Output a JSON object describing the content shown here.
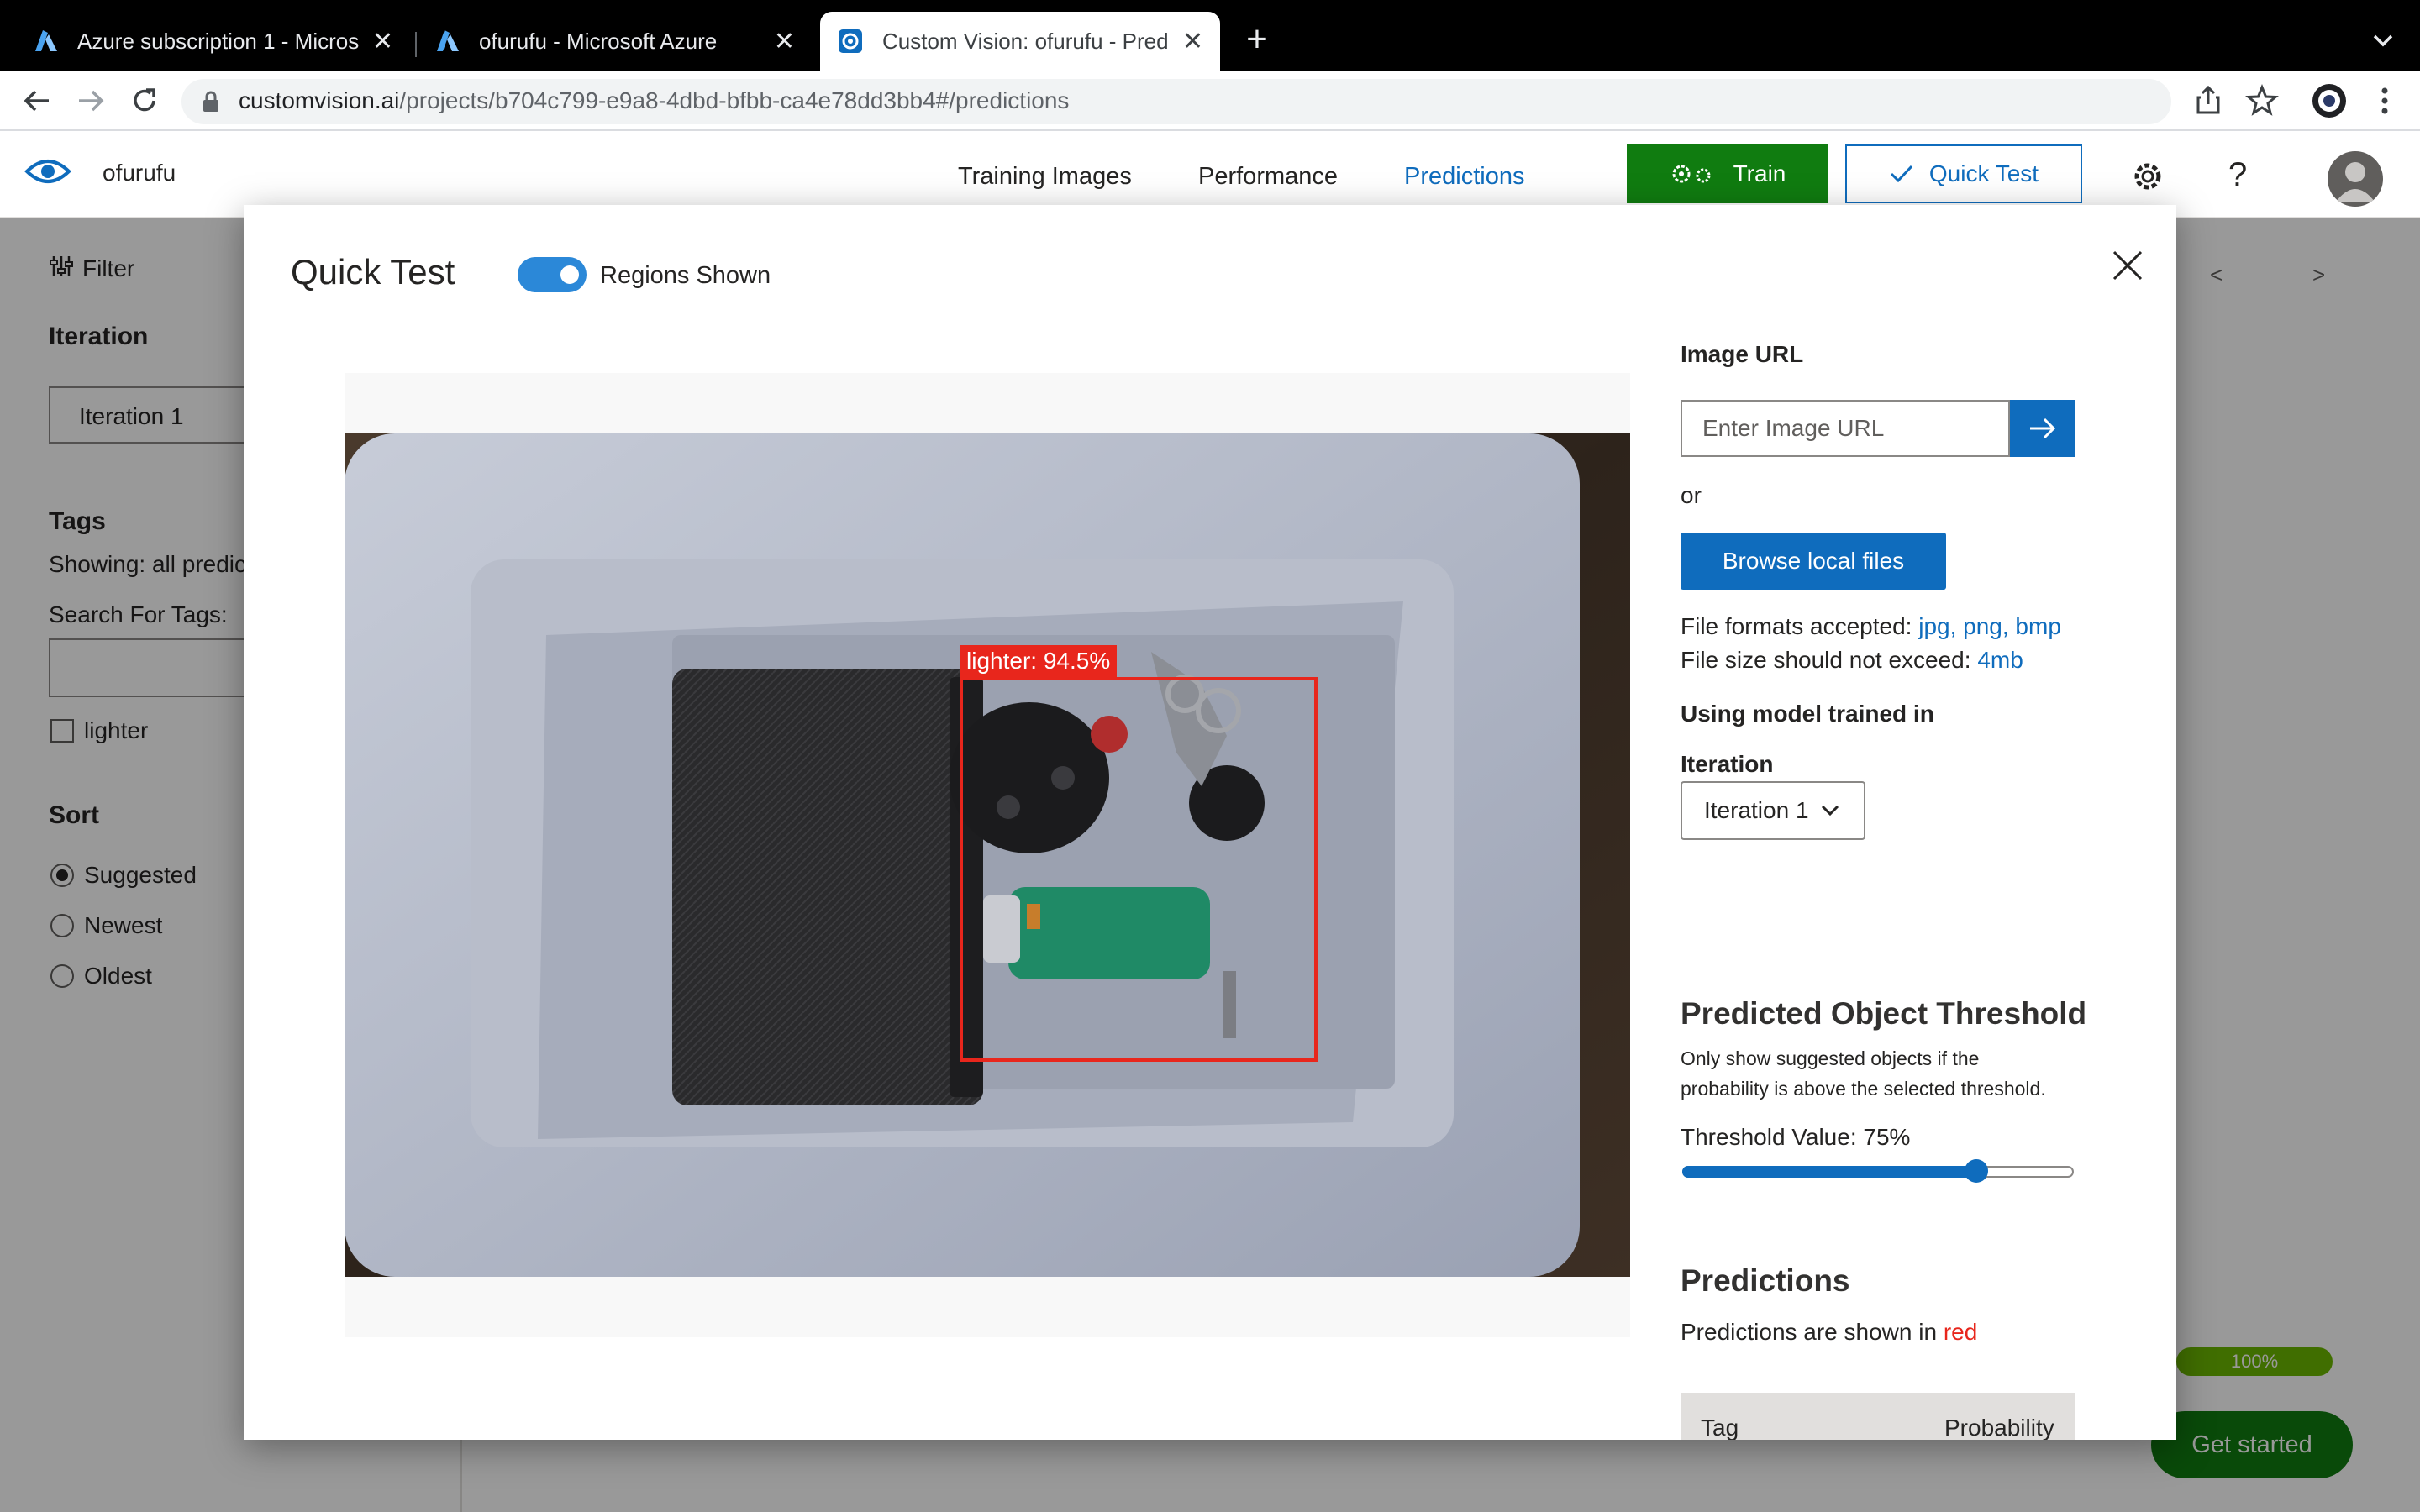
{
  "browser": {
    "tabs": [
      {
        "title": "Azure subscription 1 - Microso",
        "favicon": "azure-icon",
        "active": false
      },
      {
        "title": "ofurufu - Microsoft Azure",
        "favicon": "azure-icon",
        "active": false
      },
      {
        "title": "Custom Vision: ofurufu - Predic",
        "favicon": "custom-vision-icon",
        "active": true
      }
    ],
    "close_glyph": "✕",
    "new_tab_glyph": "+",
    "url_host": "customvision.ai",
    "url_path": "/projects/b704c799-e9a8-4dbd-bfbb-ca4e78dd3bb4#/predictions"
  },
  "app": {
    "project_name": "ofurufu",
    "nav": [
      {
        "label": "Training Images",
        "active": false
      },
      {
        "label": "Performance",
        "active": false
      },
      {
        "label": "Predictions",
        "active": true
      }
    ],
    "train_label": "Train",
    "quick_test_label": "Quick Test",
    "help_glyph": "?"
  },
  "sidebar": {
    "filter_label": "Filter",
    "iteration_heading": "Iteration",
    "iteration_value": "Iteration 1",
    "tags_heading": "Tags",
    "showing_text": "Showing: all predic",
    "search_tags_label": "Search For Tags:",
    "tag_items": [
      "lighter"
    ],
    "sort_heading": "Sort",
    "sort_options": [
      {
        "label": "Suggested",
        "checked": true
      },
      {
        "label": "Newest",
        "checked": false
      },
      {
        "label": "Oldest",
        "checked": false
      }
    ]
  },
  "background": {
    "pager_prev": "<",
    "pager_next": ">",
    "progress_label": "100%",
    "progress_value": 1.0,
    "get_started_label": "Get started"
  },
  "quick_test": {
    "title": "Quick Test",
    "regions_toggle_label": "Regions Shown",
    "regions_shown": true,
    "image_url_label": "Image URL",
    "image_url_placeholder": "Enter Image URL",
    "or_label": "or",
    "browse_label": "Browse local files",
    "file_formats_prefix": "File formats accepted:",
    "file_formats": "jpg, png, bmp",
    "file_size_prefix": "File size should not exceed:",
    "file_size": "4mb",
    "model_heading": "Using model trained in",
    "iteration_label": "Iteration",
    "iteration_selected": "Iteration 1",
    "threshold_title": "Predicted Object Threshold",
    "threshold_desc_1": "Only show suggested objects if the",
    "threshold_desc_2": "probability is above the selected threshold.",
    "threshold_label": "Threshold Value: 75%",
    "threshold_value": 0.75,
    "predictions_title": "Predictions",
    "predictions_note_prefix": "Predictions are shown in",
    "predictions_note_color_word": "red",
    "table_headers": [
      "Tag",
      "Probability"
    ],
    "detected_region": {
      "tag": "lighter",
      "probability": 0.945,
      "label": "lighter: 94.5%"
    }
  },
  "colors": {
    "accent": "#0f6cbd",
    "train_green": "#107c10",
    "region_red": "#e8261c",
    "progress_green": "#6bb700"
  }
}
